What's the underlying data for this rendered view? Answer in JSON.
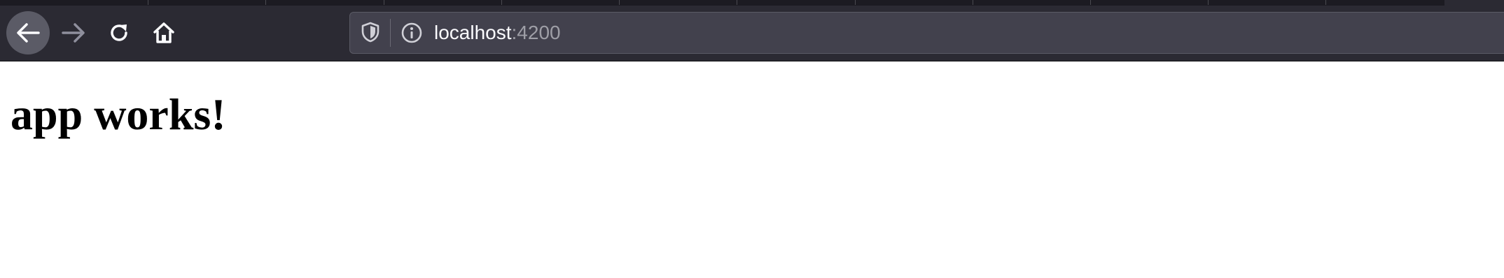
{
  "browser": {
    "toolbar": {
      "back_icon": "arrow-left-icon",
      "forward_icon": "arrow-right-icon",
      "reload_icon": "reload-icon",
      "home_icon": "home-icon"
    },
    "urlbar": {
      "tracking_icon": "shield-icon",
      "info_icon": "info-icon",
      "host": "localhost",
      "port": ":4200"
    },
    "colors": {
      "chrome_bg": "#2b2a33",
      "tabstrip_bg": "#1c1b22",
      "urlbar_bg": "#42414d",
      "back_button_bg": "#5b5b66",
      "url_text": "#fbfbfe",
      "url_port_text": "#9e9ea6"
    }
  },
  "page": {
    "heading": "app works!"
  }
}
